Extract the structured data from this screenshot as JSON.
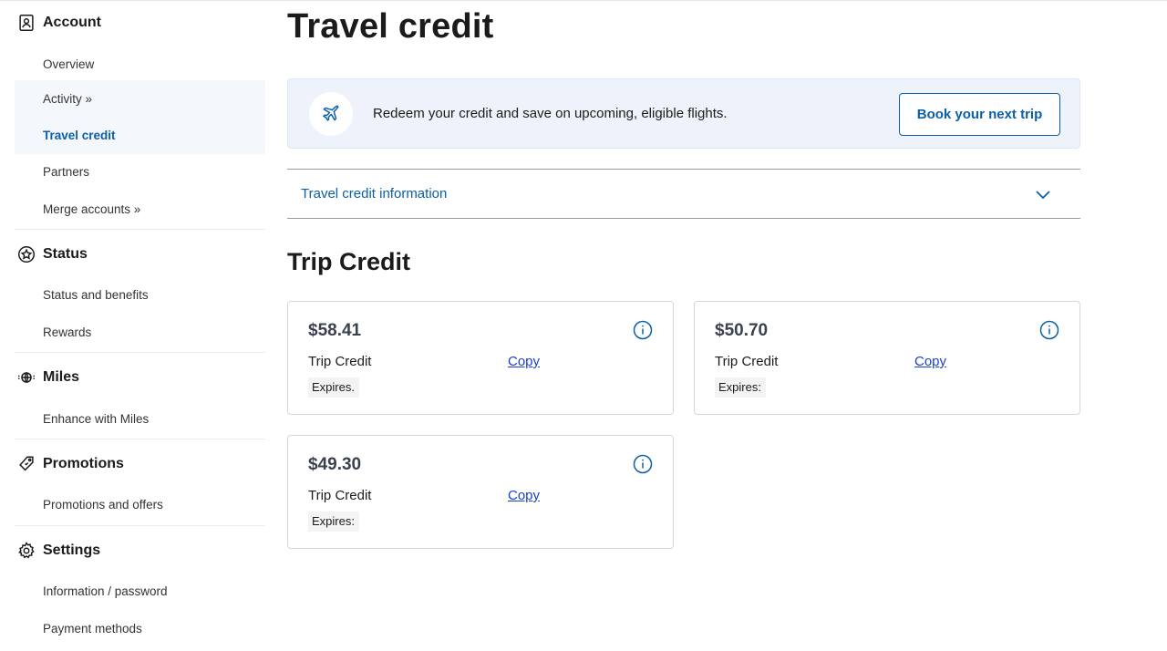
{
  "sidebar": {
    "sections": [
      {
        "title": "Account",
        "icon": "account-icon",
        "items": [
          "Overview",
          "Activity »",
          "Travel credit",
          "Partners",
          "Merge accounts »"
        ]
      },
      {
        "title": "Status",
        "icon": "star-badge-icon",
        "items": [
          "Status and benefits",
          "Rewards"
        ]
      },
      {
        "title": "Miles",
        "icon": "miles-icon",
        "items": [
          "Enhance with Miles"
        ]
      },
      {
        "title": "Promotions",
        "icon": "tag-icon",
        "items": [
          "Promotions and offers"
        ]
      },
      {
        "title": "Settings",
        "icon": "gear-icon",
        "items": [
          "Information / password",
          "Payment methods"
        ]
      }
    ],
    "active_item": "Travel credit"
  },
  "main": {
    "title": "Travel credit",
    "banner": {
      "icon": "airplane-icon",
      "message": "Redeem your credit and save on upcoming, eligible flights.",
      "button": "Book your next trip"
    },
    "accordion": {
      "label": "Travel credit information",
      "icon": "chevron-down-icon"
    },
    "section_title": "Trip Credit",
    "credits": [
      {
        "amount": "$58.41",
        "label": "Trip Credit",
        "copy": "Copy",
        "expires": "Expires."
      },
      {
        "amount": "$50.70",
        "label": "Trip Credit",
        "copy": "Copy",
        "expires": "Expires:"
      },
      {
        "amount": "$49.30",
        "label": "Trip Credit",
        "copy": "Copy",
        "expires": "Expires:"
      }
    ]
  },
  "colors": {
    "accent": "#0b5fa8",
    "link": "#1a3fd0",
    "banner_bg": "#eef3fb",
    "active_bg": "#f4f7fc"
  }
}
